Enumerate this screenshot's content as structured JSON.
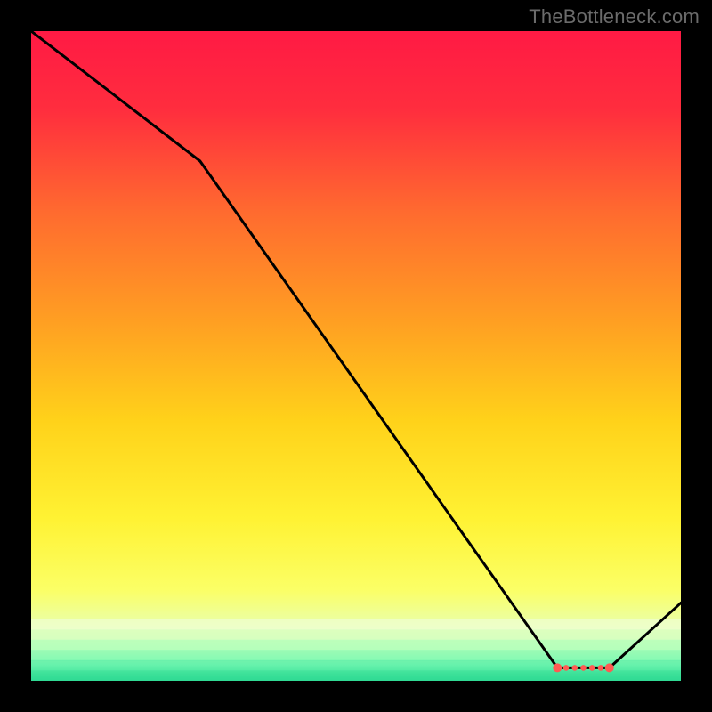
{
  "watermark": "TheBottleneck.com",
  "chart_data": {
    "type": "line",
    "title": "",
    "xlabel": "",
    "ylabel": "",
    "xlim": [
      0,
      100
    ],
    "ylim": [
      0,
      100
    ],
    "x": [
      0,
      26,
      81,
      89,
      100
    ],
    "values": [
      100,
      80,
      2,
      2,
      12
    ],
    "ideal_range_x": [
      81,
      89
    ],
    "gradient_stops": [
      {
        "offset": 0.0,
        "color": "#ff1a44"
      },
      {
        "offset": 0.12,
        "color": "#ff2d3e"
      },
      {
        "offset": 0.28,
        "color": "#ff6b2f"
      },
      {
        "offset": 0.45,
        "color": "#ffa022"
      },
      {
        "offset": 0.6,
        "color": "#ffd21a"
      },
      {
        "offset": 0.75,
        "color": "#fff233"
      },
      {
        "offset": 0.86,
        "color": "#fbff66"
      },
      {
        "offset": 0.92,
        "color": "#e8ffb0"
      },
      {
        "offset": 0.955,
        "color": "#c6ffb8"
      },
      {
        "offset": 0.975,
        "color": "#8bffb9"
      },
      {
        "offset": 0.99,
        "color": "#45e59a"
      },
      {
        "offset": 1.0,
        "color": "#2bd68f"
      }
    ],
    "ideal_band_colors": [
      "#f1ffe0",
      "#d5ffc8",
      "#a6ffbf",
      "#72f5b1",
      "#4be8a2",
      "#33dd97"
    ],
    "marker_color": "#ff5a52",
    "line_color": "#000000"
  }
}
